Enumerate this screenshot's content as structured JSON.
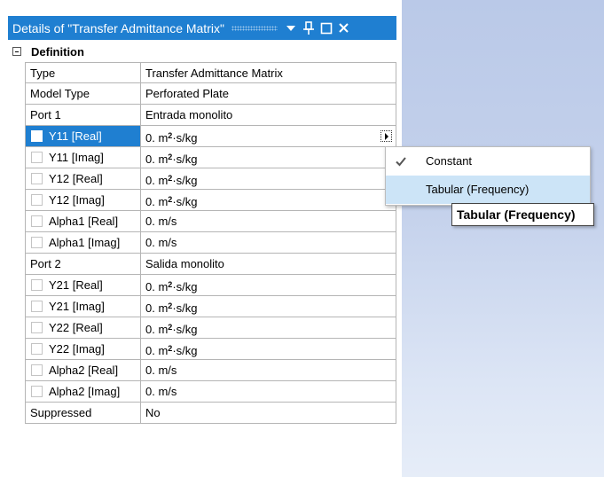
{
  "panel": {
    "title": "Details of \"Transfer Admittance Matrix\"",
    "section_label": "Definition"
  },
  "rows": [
    {
      "name": "Type",
      "value": "Transfer Admittance Matrix"
    },
    {
      "name": "Model Type",
      "value": "Perforated Plate"
    },
    {
      "name": "Port 1",
      "value": "Entrada monolito"
    },
    {
      "name": "Y11 [Real]",
      "value_prefix": "0. m",
      "value_sup": "2",
      "value_suffix": "·s/kg"
    },
    {
      "name": "Y11 [Imag]",
      "value_prefix": "0. m",
      "value_sup": "2",
      "value_suffix": "·s/kg"
    },
    {
      "name": "Y12 [Real]",
      "value_prefix": "0. m",
      "value_sup": "2",
      "value_suffix": "·s/kg"
    },
    {
      "name": "Y12 [Imag]",
      "value_prefix": "0. m",
      "value_sup": "2",
      "value_suffix": "·s/kg"
    },
    {
      "name": "Alpha1 [Real]",
      "value": "0. m/s"
    },
    {
      "name": "Alpha1 [Imag]",
      "value": "0. m/s"
    },
    {
      "name": "Port 2",
      "value": "Salida monolito"
    },
    {
      "name": "Y21 [Real]",
      "value_prefix": "0. m",
      "value_sup": "2",
      "value_suffix": "·s/kg"
    },
    {
      "name": "Y21 [Imag]",
      "value_prefix": "0. m",
      "value_sup": "2",
      "value_suffix": "·s/kg"
    },
    {
      "name": "Y22 [Real]",
      "value_prefix": "0. m",
      "value_sup": "2",
      "value_suffix": "·s/kg"
    },
    {
      "name": "Y22 [Imag]",
      "value_prefix": "0. m",
      "value_sup": "2",
      "value_suffix": "·s/kg"
    },
    {
      "name": "Alpha2 [Real]",
      "value": "0. m/s"
    },
    {
      "name": "Alpha2 [Imag]",
      "value": "0. m/s"
    },
    {
      "name": "Suppressed",
      "value": "No"
    }
  ],
  "menu": {
    "items": [
      {
        "label": "Constant",
        "checked": true
      },
      {
        "label": "Tabular (Frequency)",
        "checked": false
      }
    ]
  },
  "tooltip": {
    "text": "Tabular (Frequency)"
  },
  "icons": {
    "dropdown": "chevron-down-icon",
    "pin": "pin-icon",
    "maximize": "maximize-icon",
    "close": "close-icon",
    "flyout": "flyout-arrow-icon",
    "check": "check-icon",
    "collapse": "collapse-icon"
  },
  "colors": {
    "title_bar": "#1f7fd1",
    "selected_row": "#1f7fd1",
    "menu_hover": "#cce4f7",
    "background_right": "#c5d2ec"
  }
}
